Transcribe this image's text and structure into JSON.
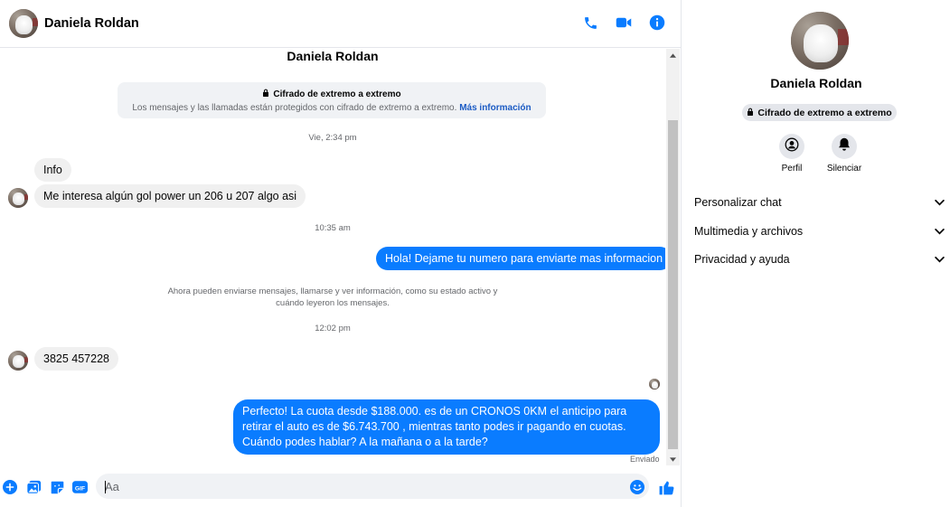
{
  "header": {
    "contact_name": "Daniela Roldan",
    "actions": [
      {
        "name": "phone-icon",
        "color": "#0a7cff"
      },
      {
        "name": "video-icon",
        "color": "#0a7cff"
      },
      {
        "name": "info-icon",
        "color": "#0a7cff"
      }
    ]
  },
  "conversation": {
    "title": "Daniela Roldan",
    "e2e_notice": {
      "title": "Cifrado de extremo a extremo",
      "description": "Los mensajes y las llamadas están protegidos con cifrado de extremo a extremo.",
      "link": "Más información"
    },
    "timestamps": [
      "Vie, 2:34 pm",
      "10:35 am",
      "12:02 pm"
    ],
    "system_note": "Ahora pueden enviarse mensajes, llamarse y ver información, como su estado activo y cuándo leyeron los mensajes.",
    "messages": [
      {
        "from": "contact",
        "text": "Info"
      },
      {
        "from": "contact",
        "text": "Me interesa algún gol power un 206 u 207 algo asi"
      },
      {
        "from": "me",
        "text": "Hola! Dejame tu numero para enviarte mas informacion"
      },
      {
        "from": "contact",
        "text": "3825 457228"
      },
      {
        "from": "me",
        "text": "Perfecto! La cuota desde $188.000. es de un CRONOS 0KM el anticipo para retirar el auto es de $6.743.700 , mientras tanto podes ir pagando en cuotas. Cuándo podes hablar? A la mañana o a la tarde?"
      }
    ],
    "status": "Enviado",
    "colors": {
      "outgoing_bubble": "#0a7cff",
      "incoming_bubble": "#f0f0f0"
    }
  },
  "composer": {
    "placeholder": "Aa",
    "icons": [
      "plus-icon",
      "photo-icon",
      "sticker-icon",
      "gif-icon",
      "emoji-icon",
      "thumbs-up-icon"
    ],
    "gif_label": "GIF"
  },
  "panel": {
    "name": "Daniela Roldan",
    "e2e_badge": "Cifrado de extremo a extremo",
    "actions": [
      {
        "label": "Perfil",
        "icon": "profile-icon"
      },
      {
        "label": "Silenciar",
        "icon": "bell-icon"
      }
    ],
    "sections": [
      {
        "label": "Personalizar chat"
      },
      {
        "label": "Multimedia y archivos"
      },
      {
        "label": "Privacidad y ayuda"
      }
    ]
  }
}
